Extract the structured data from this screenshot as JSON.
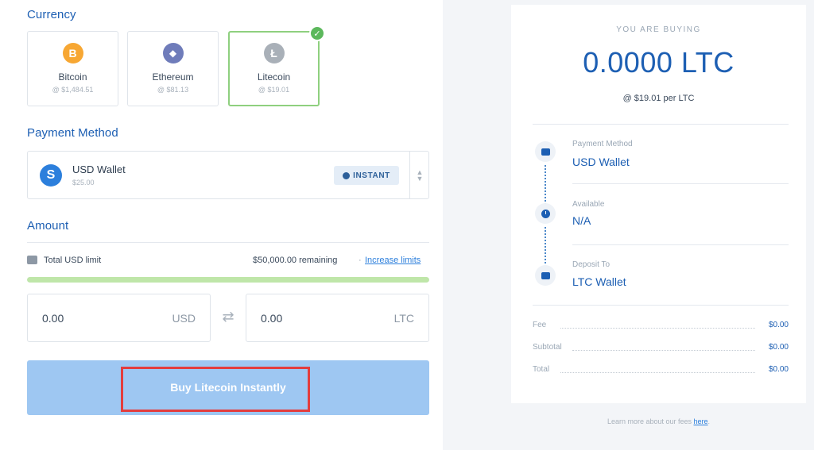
{
  "currency": {
    "title": "Currency",
    "options": [
      {
        "name": "Bitcoin",
        "price": "@ $1,484.51",
        "symbol": "B",
        "color": "#f7a733",
        "selected": false
      },
      {
        "name": "Ethereum",
        "price": "@ $81.13",
        "symbol": "◆",
        "color": "#6f7cba",
        "selected": false
      },
      {
        "name": "Litecoin",
        "price": "@ $19.01",
        "symbol": "Ł",
        "color": "#a9b0b8",
        "selected": true
      }
    ],
    "selected_check": "✓"
  },
  "payment": {
    "title": "Payment Method",
    "icon": "S",
    "wallet_name": "USD Wallet",
    "wallet_balance": "$25.00",
    "badge": "INSTANT"
  },
  "amount": {
    "title": "Amount",
    "limit_label": "Total USD limit",
    "limit_remaining": "$50,000.00 remaining",
    "limit_separator": "·",
    "limit_link": "Increase limits",
    "limit_fraction_remaining": 1.0,
    "usd_value": "0.00",
    "usd_unit": "USD",
    "ltc_value": "0.00",
    "ltc_unit": "LTC",
    "swap_icon": "⇄"
  },
  "buy_button": {
    "label": "Buy Litecoin Instantly",
    "highlighted": true,
    "highlight_color": "#e33d3d"
  },
  "summary": {
    "heading": "YOU ARE BUYING",
    "amount": "0.0000 LTC",
    "rate": "@ $19.01 per LTC",
    "steps": [
      {
        "label": "Payment Method",
        "value": "USD Wallet",
        "icon": "wallet-icon"
      },
      {
        "label": "Available",
        "value": "N/A",
        "icon": "clock-icon"
      },
      {
        "label": "Deposit To",
        "value": "LTC Wallet",
        "icon": "wallet-icon"
      }
    ],
    "fees": [
      {
        "label": "Fee",
        "value": "$0.00"
      },
      {
        "label": "Subtotal",
        "value": "$0.00"
      },
      {
        "label": "Total",
        "value": "$0.00"
      }
    ]
  },
  "footer": {
    "text": "Learn more about our fees ",
    "link": "here",
    "end": "."
  }
}
